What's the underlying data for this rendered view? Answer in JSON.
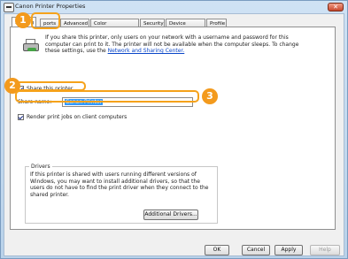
{
  "window": {
    "title": "Canon Printer Properties"
  },
  "tabs": [
    {
      "label": "Sharing",
      "active": true
    },
    {
      "label": "ports",
      "active": false
    },
    {
      "label": "Advanced",
      "active": false
    },
    {
      "label": "Color Management",
      "active": false
    },
    {
      "label": "Security",
      "active": false
    },
    {
      "label": "Device Settings",
      "active": false
    },
    {
      "label": "Profile",
      "active": false
    }
  ],
  "sharing": {
    "intro": "If you share this printer, only users on your network with a username and password for this computer can print to it. The printer will not be available when the computer sleeps. To change these settings, use the",
    "intro_link": "Network and Sharing Center.",
    "share_printer_label": "Share this printer",
    "share_printer_checked": true,
    "share_name_label": "Share name:",
    "share_name_value": "Canon Printer",
    "render_jobs_label": "Render print jobs on client computers",
    "render_jobs_checked": true
  },
  "drivers": {
    "legend": "Drivers",
    "text": "If this printer is shared with users running different versions of Windows, you may want to install additional drivers, so that the users do not have to find the print driver when they connect to the shared printer.",
    "additional_button": "Additional Drivers..."
  },
  "footer": {
    "ok": "OK",
    "cancel": "Cancel",
    "apply": "Apply",
    "help": "Help"
  },
  "callouts": [
    "1",
    "2",
    "3"
  ],
  "colors": {
    "accent": "#f39a1d",
    "selection": "#3399ff",
    "link": "#0a46c8"
  }
}
